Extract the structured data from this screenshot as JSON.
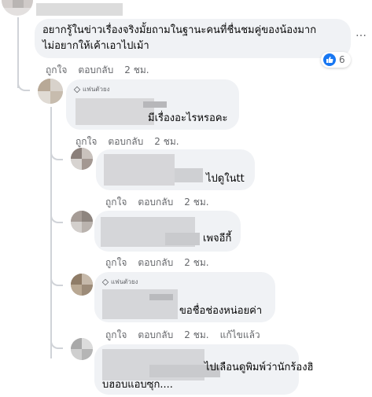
{
  "comments": [
    {
      "text_line1": "อยากรู้ในข่าวเรื่องจริงมั้ยถามในฐานะคนที่ชื่นชมคู่ของน้องมาก",
      "text_line2": "ไม่อยากให้เค้าเอาไปเม้า",
      "like": "ถูกใจ",
      "reply": "ตอบกลับ",
      "time": "2 ชม.",
      "reaction_count": "6"
    },
    {
      "badge": "แฟนตัวยง",
      "text": "มีเรื่องอะไรหรอคะ",
      "like": "ถูกใจ",
      "reply": "ตอบกลับ",
      "time": "2 ชม."
    },
    {
      "text": "ไปดูในtt",
      "like": "ถูกใจ",
      "reply": "ตอบกลับ",
      "time": "2 ชม."
    },
    {
      "text": "เพจอีกี้",
      "like": "ถูกใจ",
      "reply": "ตอบกลับ",
      "time": "2 ชม."
    },
    {
      "badge": "แฟนตัวยง",
      "text": "ขอชื่อช่องหน่อยค่า",
      "like": "ถูกใจ",
      "reply": "ตอบกลับ",
      "time": "2 ชม.",
      "edited": "แก้ไขแล้ว"
    },
    {
      "text_line1": "ไปเลือนดูพิมพ์ว่านักร้องฮิ",
      "text_line2": "บฮอบแอบซุก...."
    }
  ],
  "more_options": "…",
  "colors": {
    "bubble": "#f0f2f5",
    "muted": "#65676b",
    "like_blue": "#1877f2"
  }
}
